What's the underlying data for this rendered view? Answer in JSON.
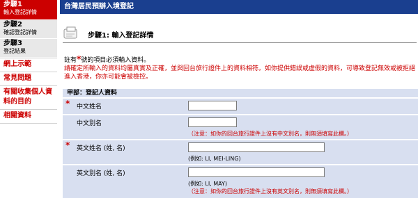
{
  "sidebar": {
    "steps": [
      {
        "title": "步驟1",
        "sub": "輸入登記詳情"
      },
      {
        "title": "步驟2",
        "sub": "確認登記詳情"
      },
      {
        "title": "步驟3",
        "sub": "登記結果"
      }
    ],
    "links": [
      "網上示範",
      "常見問題",
      "有關收集個人資料的目的",
      "相關資料"
    ]
  },
  "topbar": {
    "title": "台灣居民預辦入境登記"
  },
  "header": {
    "title": "步驟1: 輸入登記詳情"
  },
  "note": {
    "prefix": "註有",
    "star": "*",
    "suffix": "號的項目必須輸入資料。",
    "warning": "請確定所輸入的資料均屬真實及正確，並與回台旅行證件上的資料相符。如你提供錯誤或虛假的資料，可導致登記無效或被拒絕進入香港，你亦可能會被檢控。"
  },
  "section": {
    "title": "甲部：登記人資料"
  },
  "fields": [
    {
      "label": "中文姓名",
      "required": true,
      "value": "",
      "hint": ""
    },
    {
      "label": "中文別名",
      "required": false,
      "value": "",
      "hint": "（注意：如你的回台旅行證件上沒有中文別名，則無須填寫此欄。）"
    },
    {
      "label": "英文姓名 (姓, 名)",
      "required": true,
      "value": "",
      "hint": "(例如: LI, MEI-LING)"
    },
    {
      "label": "英文別名 (姓, 名)",
      "required": false,
      "value": "",
      "hint": "(例如: LI, MAY)",
      "hint2": "（注意：如你的回台旅行證件上沒有英文別名，則無須填寫此欄。）"
    }
  ],
  "colors": {
    "accent": "#cc0000",
    "topbar": "#1a3f8f",
    "rowbg": "#d8dff0"
  }
}
